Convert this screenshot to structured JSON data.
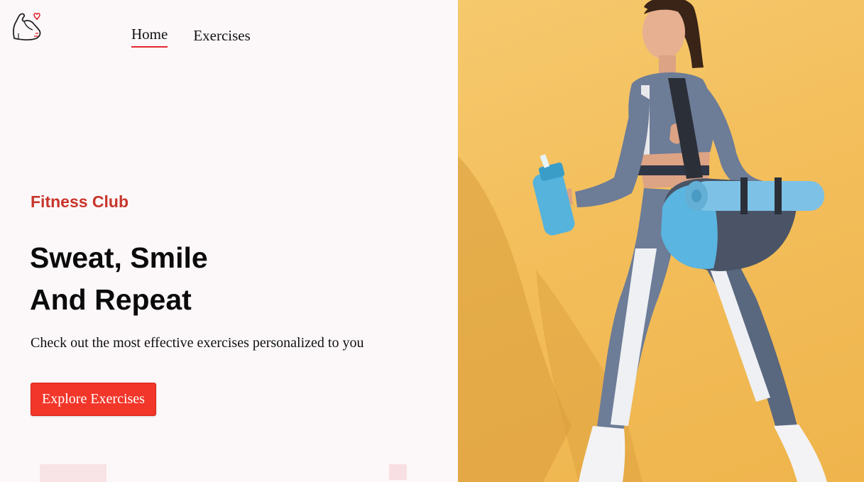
{
  "nav": {
    "items": [
      {
        "label": "Home",
        "active": true
      },
      {
        "label": "Exercises",
        "active": false
      }
    ]
  },
  "hero": {
    "eyebrow": "Fitness Club",
    "headline_line1": "Sweat, Smile",
    "headline_line2": "And Repeat",
    "subtext": "Check out the most effective exercises personalized to you",
    "cta_label": "Explore Exercises",
    "image": "woman-walking-with-gym-bag-and-water-bottle"
  },
  "colors": {
    "accent": "#f2362a",
    "eyebrow": "#c8352b",
    "background": "#fcf8f9",
    "hero_bg": "#f3be5b"
  }
}
